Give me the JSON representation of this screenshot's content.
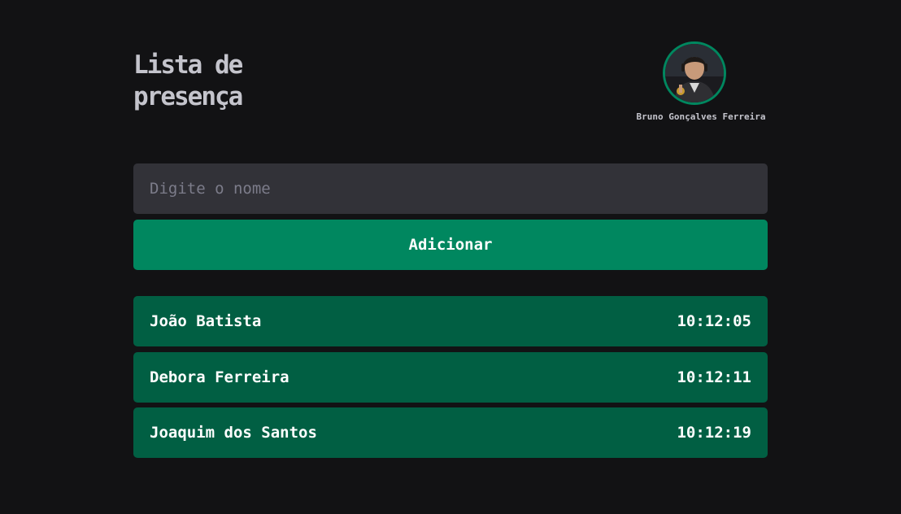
{
  "header": {
    "title": "Lista de presença",
    "user": {
      "name": "Bruno Gonçalves Ferreira",
      "avatar_icon": "user-avatar-photo"
    }
  },
  "form": {
    "input_placeholder": "Digite o nome",
    "input_value": "",
    "add_label": "Adicionar"
  },
  "students": [
    {
      "name": "João Batista",
      "time": "10:12:05"
    },
    {
      "name": "Debora Ferreira",
      "time": "10:12:11"
    },
    {
      "name": "Joaquim dos Santos",
      "time": "10:12:19"
    }
  ],
  "colors": {
    "background": "#121214",
    "accent": "#00875f",
    "card": "#015f43",
    "input": "#323238",
    "text_muted": "#c4c4cc"
  }
}
